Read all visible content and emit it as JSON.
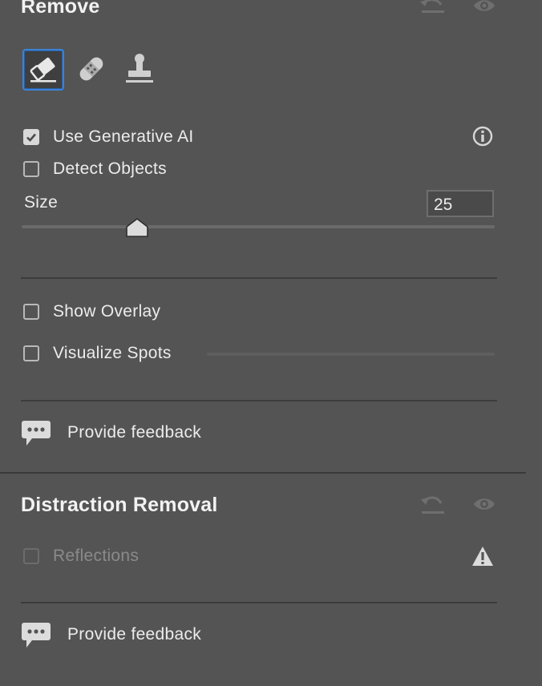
{
  "remove": {
    "title": "Remove",
    "tools": [
      {
        "name": "eraser-tool",
        "icon": "eraser-icon",
        "active": true
      },
      {
        "name": "heal-tool",
        "icon": "bandage-icon",
        "active": false
      },
      {
        "name": "clone-tool",
        "icon": "stamp-icon",
        "active": false
      }
    ],
    "use_generative_ai": {
      "label": "Use Generative AI",
      "checked": true
    },
    "detect_objects": {
      "label": "Detect Objects",
      "checked": false
    },
    "size": {
      "label": "Size",
      "value": "25",
      "slider_fraction": 0.25
    },
    "show_overlay": {
      "label": "Show Overlay",
      "checked": false
    },
    "visualize_spots": {
      "label": "Visualize Spots",
      "checked": false
    },
    "feedback": {
      "label": "Provide feedback"
    }
  },
  "distraction_removal": {
    "title": "Distraction Removal",
    "reflections": {
      "label": "Reflections",
      "checked": false,
      "disabled": true
    },
    "feedback": {
      "label": "Provide feedback"
    }
  },
  "colors": {
    "background": "#545454",
    "accent": "#3b82d8",
    "divider": "#3c3c3c"
  }
}
